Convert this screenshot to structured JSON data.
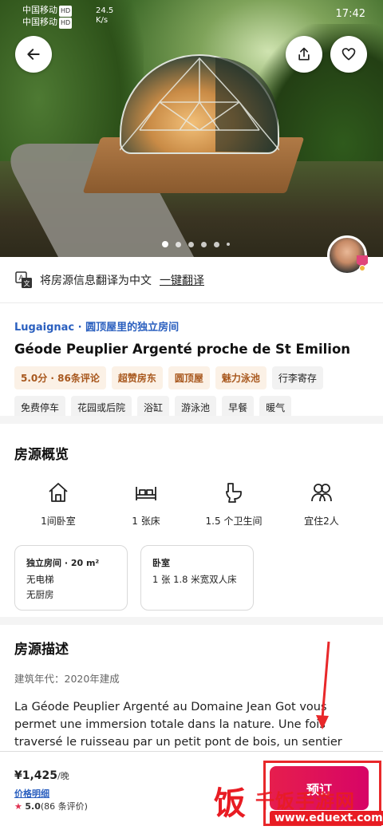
{
  "status_bar": {
    "carrier1": "中国移动",
    "carrier2": "中国移动",
    "hd": "HD",
    "speed": "24.5",
    "speed_unit": "K/s",
    "time": "17:42"
  },
  "hero": {
    "carousel_count": 6,
    "carousel_active": 0
  },
  "translate": {
    "text": "将房源信息翻译为中文",
    "action": "一键翻译"
  },
  "listing": {
    "subtitle": "Lugaignac · 圆顶屋里的独立房间",
    "title": "Géode Peuplier Argenté proche de St Emilion",
    "tags": [
      {
        "label": "5.0分 · 86条评论",
        "highlight": true
      },
      {
        "label": "超赞房东",
        "highlight": true
      },
      {
        "label": "圆顶屋",
        "highlight": true
      },
      {
        "label": "魅力泳池",
        "highlight": true
      },
      {
        "label": "行李寄存",
        "highlight": false
      },
      {
        "label": "免费停车",
        "highlight": false
      },
      {
        "label": "花园或后院",
        "highlight": false
      },
      {
        "label": "浴缸",
        "highlight": false
      },
      {
        "label": "游泳池",
        "highlight": false
      },
      {
        "label": "早餐",
        "highlight": false
      },
      {
        "label": "暖气",
        "highlight": false
      }
    ]
  },
  "overview": {
    "title": "房源概览",
    "amenities": [
      {
        "icon": "house-icon",
        "label": "1间卧室"
      },
      {
        "icon": "bed-icon",
        "label": "1 张床"
      },
      {
        "icon": "toilet-icon",
        "label": "1.5 个卫生间"
      },
      {
        "icon": "guests-icon",
        "label": "宜住2人"
      }
    ],
    "card1": {
      "title": "独立房间 · 20 m²",
      "line1": "无电梯",
      "line2": "无厨房"
    },
    "card2": {
      "title": "卧室",
      "line1": "1 张 1.8 米宽双人床"
    }
  },
  "description": {
    "title": "房源描述",
    "meta": "建筑年代：2020年建成",
    "text": "La Géode Peuplier Argenté au Domaine Jean Got vous permet une immersion totale dans la nature. Une fois traversé le ruisseau par un petit pont de bois, un sentier dans le..."
  },
  "booking": {
    "price": "¥1,425",
    "unit": "/晚",
    "price_detail": "价格明细",
    "rating": "5.0",
    "reviews": "(86 条评价)",
    "button": "预订"
  },
  "watermark": {
    "logo_char": "饭",
    "name": "千饭手游网",
    "url": "www.eduext.com"
  },
  "colors": {
    "accent_blue": "#2a5fbf",
    "book_button": "#e61e4d",
    "highlight_tag_text": "#a8581e",
    "annotation_red": "#e8282a"
  }
}
